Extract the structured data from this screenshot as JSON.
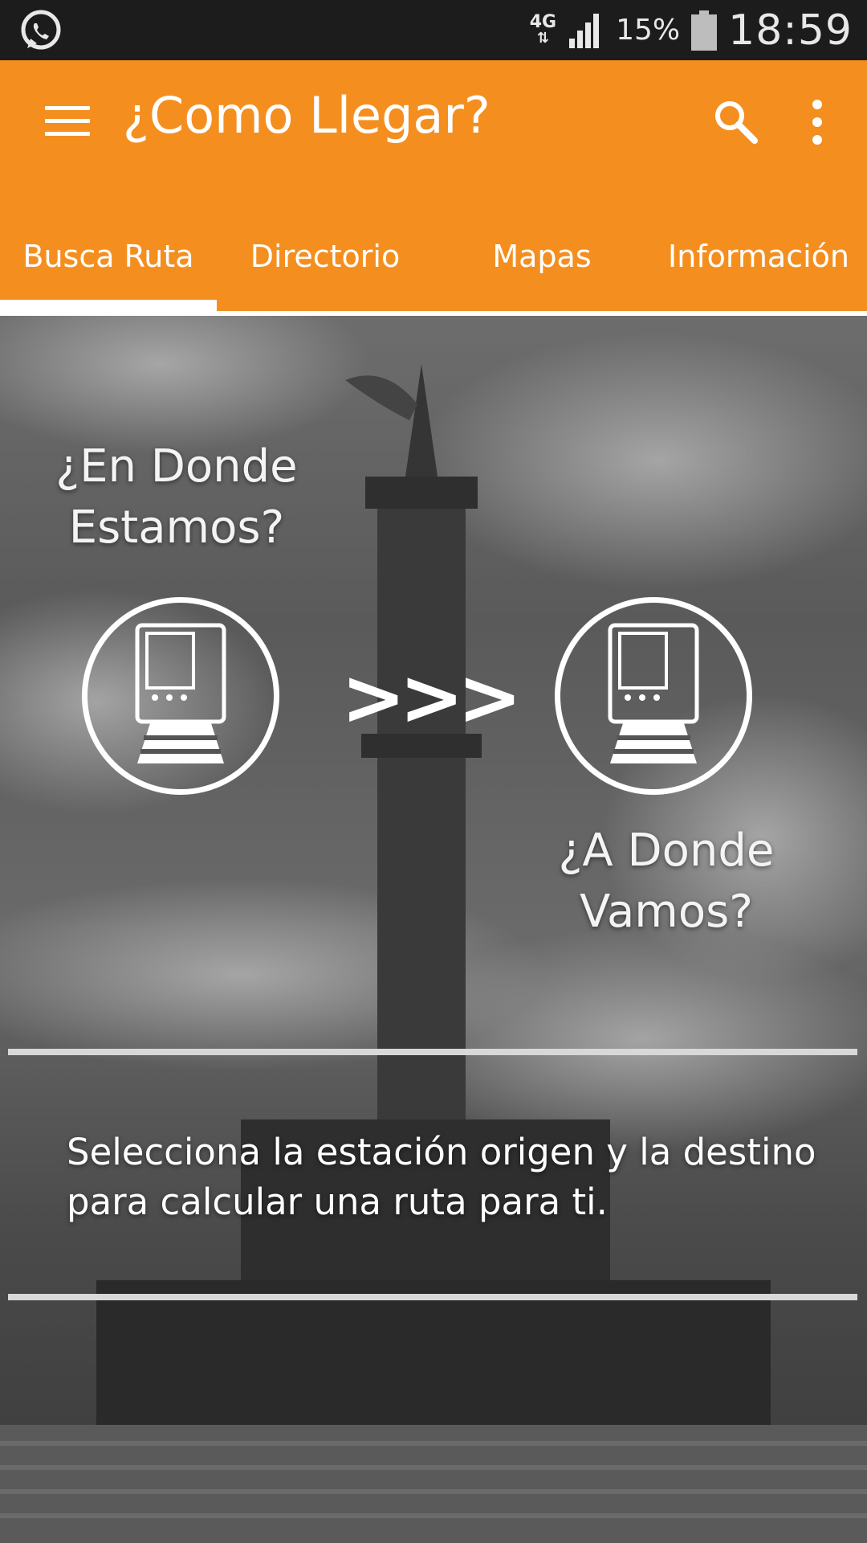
{
  "status_bar": {
    "network": "4G",
    "battery_percent": "15%",
    "time": "18:59",
    "notification_icon": "whatsapp-icon"
  },
  "app_bar": {
    "title": "¿Como Llegar?",
    "color": "#f48f1f",
    "icons": [
      "menu-icon",
      "search-icon",
      "overflow-menu-icon"
    ]
  },
  "tabs": [
    {
      "label": "Busca Ruta",
      "selected": true
    },
    {
      "label": "Directorio",
      "selected": false
    },
    {
      "label": "Mapas",
      "selected": false
    },
    {
      "label": "Información",
      "selected": false
    }
  ],
  "main": {
    "origin_label": "¿En Donde Estamos?",
    "destination_label": "¿A Donde Vamos?",
    "arrows": ">>>",
    "station_icon": "train-icon",
    "instructions": "Selecciona la estación origen y la destino para calcular una ruta para ti."
  }
}
